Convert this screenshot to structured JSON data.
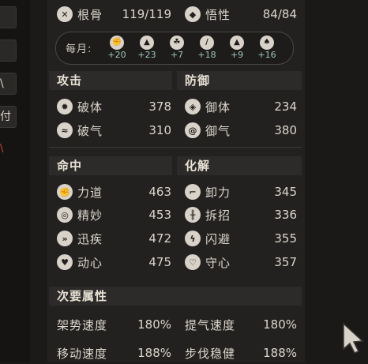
{
  "top_stats": [
    {
      "icon": "bone-icon",
      "label": "根骨",
      "value": "119/119"
    },
    {
      "icon": "insight-icon",
      "label": "悟性",
      "value": "84/84"
    }
  ],
  "monthly": {
    "label": "每月:",
    "items": [
      {
        "icon": "fist-icon",
        "value": "+20"
      },
      {
        "icon": "strength-icon",
        "value": "+23"
      },
      {
        "icon": "agility-icon",
        "value": "+7"
      },
      {
        "icon": "sword-icon",
        "value": "+18"
      },
      {
        "icon": "mountain-icon",
        "value": "+9"
      },
      {
        "icon": "brush-icon",
        "value": "+16"
      }
    ]
  },
  "attack": {
    "title": "攻击",
    "items": [
      {
        "icon": "fire-icon",
        "label": "破体",
        "value": "378"
      },
      {
        "icon": "wind-icon",
        "label": "破气",
        "value": "310"
      }
    ]
  },
  "defense": {
    "title": "防御",
    "items": [
      {
        "icon": "shield-icon",
        "label": "御体",
        "value": "234"
      },
      {
        "icon": "swirl-icon",
        "label": "御气",
        "value": "380"
      }
    ]
  },
  "hit": {
    "title": "命中",
    "items": [
      {
        "icon": "fist-icon",
        "label": "力道",
        "value": "463"
      },
      {
        "icon": "eye-icon",
        "label": "精妙",
        "value": "453"
      },
      {
        "icon": "wing-icon",
        "label": "迅疾",
        "value": "472"
      },
      {
        "icon": "heart-icon",
        "label": "动心",
        "value": "475"
      }
    ]
  },
  "resolve": {
    "title": "化解",
    "items": [
      {
        "icon": "arm-icon",
        "label": "卸力",
        "value": "345"
      },
      {
        "icon": "cross-icon",
        "label": "拆招",
        "value": "336"
      },
      {
        "icon": "lightning-icon",
        "label": "闪避",
        "value": "355"
      },
      {
        "icon": "heart-outline-icon",
        "label": "守心",
        "value": "357"
      }
    ]
  },
  "secondary": {
    "title": "次要属性",
    "items": [
      {
        "label": "架势速度",
        "value": "180%"
      },
      {
        "label": "提气速度",
        "value": "180%"
      },
      {
        "label": "移动速度",
        "value": "188%"
      },
      {
        "label": "步伐稳健",
        "value": "188%"
      }
    ]
  },
  "left_tabs": [
    "",
    "",
    "\\",
    "付",
    "\\"
  ]
}
